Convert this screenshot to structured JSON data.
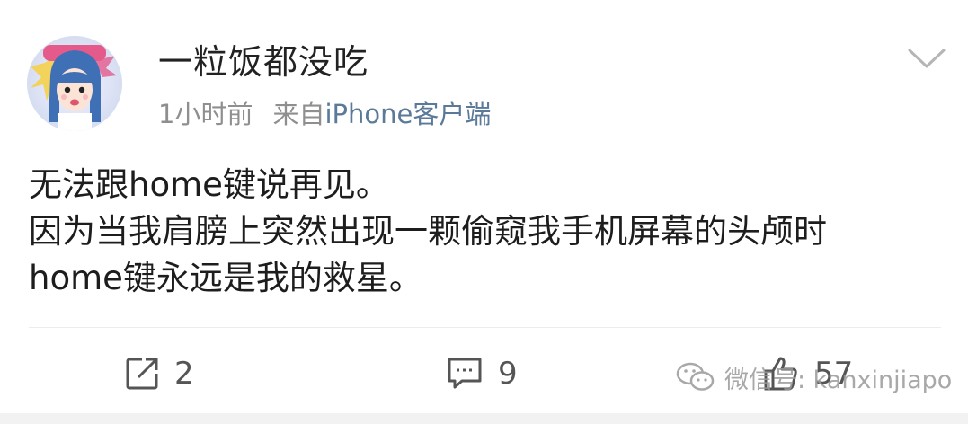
{
  "post": {
    "username": "一粒饭都没吃",
    "time": "1小时前",
    "source_prefix": "来自",
    "client": "iPhone客户端",
    "lines": [
      "无法跟home键说再见。",
      "因为当我肩膀上突然出现一颗偷窥我手机屏幕的头颅时",
      "home键永远是我的救星。"
    ]
  },
  "actions": {
    "forward_count": "2",
    "comment_count": "9",
    "like_count": "57"
  },
  "watermark": {
    "text": "微信号: kanxinjiapo"
  },
  "icons": {
    "avatar": "cartoon-avatar",
    "menu": "chevron-down-icon",
    "forward": "forward-icon",
    "comment": "comment-icon",
    "like": "thumbs-up-icon",
    "wechat": "wechat-icon"
  },
  "colors": {
    "username": "#222222",
    "meta": "#8f8f8f",
    "client": "#5b7a99",
    "content": "#1d1d1d",
    "action": "#555555"
  }
}
